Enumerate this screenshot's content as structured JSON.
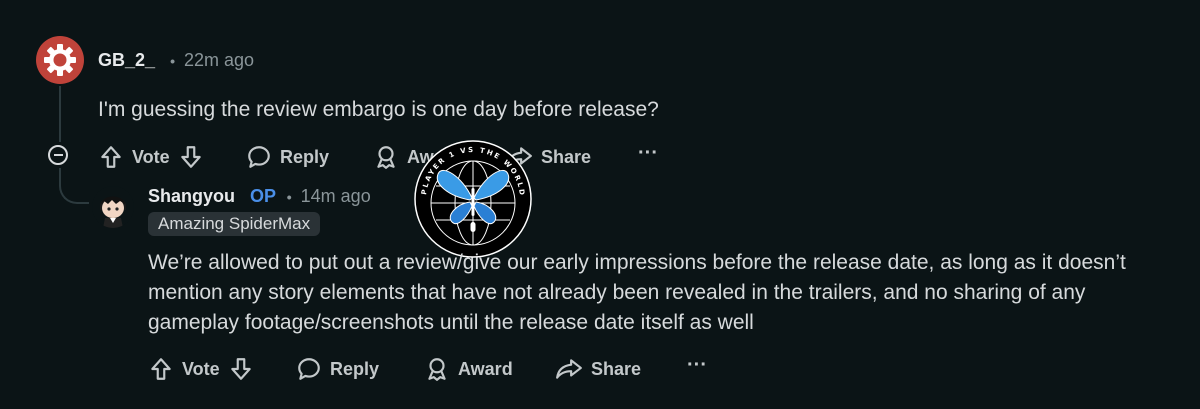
{
  "comment1": {
    "username": "GB_2_",
    "separator": "•",
    "time": "22m ago",
    "body": "I'm guessing the review embargo is one day before release?",
    "actions": {
      "vote": "Vote",
      "reply": "Reply",
      "award": "Award",
      "share": "Share",
      "more": "···"
    }
  },
  "comment2": {
    "username": "Shangyou",
    "op_badge": "OP",
    "separator": "•",
    "time": "14m ago",
    "flair": "Amazing SpiderMax",
    "body": "We’re allowed to put out a review/give our early impressions before the release date, as long as it doesn’t mention any story elements that have not already been revealed in the trailers, and no sharing of any gameplay footage/screenshots until the release date itself as well",
    "actions": {
      "vote": "Vote",
      "reply": "Reply",
      "award": "Award",
      "share": "Share",
      "more": "···"
    }
  },
  "watermark": {
    "ring_text": "PLAYER 1 VS THE WORLD",
    "accent_color": "#3a9be6"
  },
  "colors": {
    "background": "#0b1416",
    "avatar1": "#c0433a",
    "op": "#4a8fe8"
  }
}
